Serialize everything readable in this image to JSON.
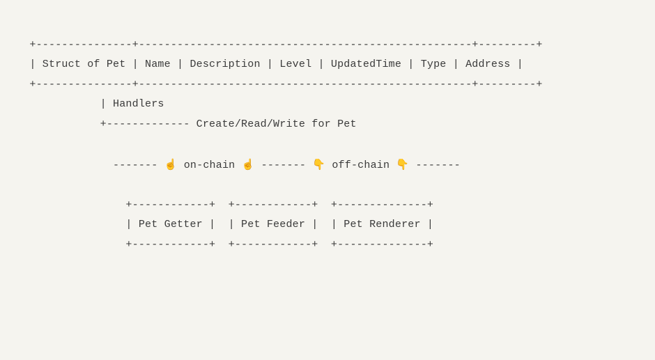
{
  "diagram": {
    "struct_section": {
      "border_top": "  +---------------+----------------------------------------------------+---------+",
      "row": "  | Struct of Pet | Name | Description | Level | UpdatedTime | Type | Address |",
      "border_bottom": "  +---------------+----------------------------------------------------+---------+"
    },
    "handlers_section": {
      "line1": "             | Handlers",
      "line2": "             +------------- Create/Read/Write for Pet"
    },
    "chain_divider": {
      "dash_left": "               ------- ",
      "on_chain_label": " on-chain ",
      "dash_mid": " ------- ",
      "off_chain_label": " off-chain ",
      "dash_right": " -------",
      "emoji_up": "☝️",
      "emoji_down": "👇"
    },
    "components": {
      "border": "                 +------------+  +------------+  +--------------+",
      "row": "                 | Pet Getter |  | Pet Feeder |  | Pet Renderer |"
    }
  }
}
